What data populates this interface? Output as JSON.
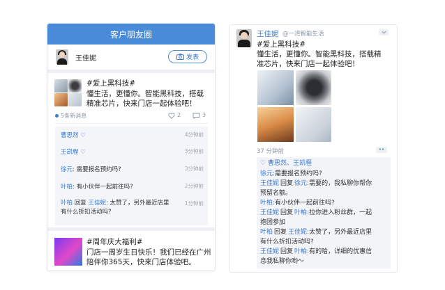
{
  "left": {
    "header": "客户朋友圈",
    "me_name": "王佳妮",
    "publish_label": "发表",
    "post1": {
      "text_line1": "#爱上黑科技#",
      "text_line2": "懂生活，更懂你。智能黑科技，搭载",
      "text_line3": "精准芯片，快来门店一起体验吧！",
      "new_messages": "5条新消息",
      "likes": "2",
      "comments": "3",
      "colors": {
        "accent": "#4a8bd9",
        "dot": "#3a7ad0"
      }
    },
    "interactions": [
      {
        "name": "曹思然",
        "kind": "like",
        "time": "4分钟前"
      },
      {
        "name": "王凯程",
        "kind": "like",
        "time": "3分钟前"
      },
      {
        "name": "徐元:",
        "text": "需要报名预约吗?",
        "time": "3分钟前"
      },
      {
        "name": "叶柏:",
        "text": "有小伙伴一起前往吗?",
        "time": "2分钟前"
      },
      {
        "name": "叶柏",
        "reply_word": "回复",
        "reply_to": "王佳妮:",
        "text_line1": "太赞了，另外最近店里",
        "text_line2": "有什么折扣活动吗?",
        "time": "1分钟前"
      }
    ],
    "post2": {
      "text_line1": "#周年庆大福利#",
      "text_line2": "门店一周岁生日快乐！我们已经在广州",
      "text_line3": "陪伴你365天，快来门店体验吧。"
    }
  },
  "right": {
    "name": "王佳妮",
    "handle": "@一湾智能生活",
    "text_line1": "#爱上黑科技#",
    "text_line2": "懂生活，更懂你。智能黑科技，搭载精",
    "text_line3": "准芯片，快来门店一起体验吧！",
    "time": "37 分钟前",
    "more_icon": "••",
    "likes_names": "曹思然、王凯程",
    "lines": [
      {
        "parts": [
          [
            "徐元:",
            "blue"
          ],
          [
            "需要报名预约吗?",
            ""
          ]
        ]
      },
      {
        "parts": [
          [
            "王佳妮",
            "blue"
          ],
          [
            "回复",
            ""
          ],
          [
            "徐元:",
            "blue"
          ],
          [
            "需要的，我私聊你帮你",
            ""
          ]
        ]
      },
      {
        "parts": [
          [
            "预留名额。",
            ""
          ]
        ]
      },
      {
        "parts": [
          [
            "叶柏:",
            "blue"
          ],
          [
            "有小伙伴一起前往吗?",
            ""
          ]
        ]
      },
      {
        "parts": [
          [
            "王佳妮",
            "blue"
          ],
          [
            "回复",
            ""
          ],
          [
            "叶柏:",
            "blue"
          ],
          [
            "拉你进入粉丝群，一起",
            ""
          ]
        ]
      },
      {
        "parts": [
          [
            "抱团参加",
            ""
          ]
        ]
      },
      {
        "parts": [
          [
            "叶柏",
            "blue"
          ],
          [
            "回复",
            ""
          ],
          [
            "王佳妮:",
            "blue"
          ],
          [
            "太赞了，另外最近店里",
            ""
          ]
        ]
      },
      {
        "parts": [
          [
            "有什么折扣活动吗?",
            ""
          ]
        ]
      },
      {
        "parts": [
          [
            "王佳妮",
            "blue"
          ],
          [
            "回复",
            ""
          ],
          [
            "叶柏:",
            "blue"
          ],
          [
            "有的哈，详细的优惠信",
            ""
          ]
        ]
      },
      {
        "parts": [
          [
            "息我私聊你哟～",
            ""
          ]
        ]
      }
    ]
  }
}
